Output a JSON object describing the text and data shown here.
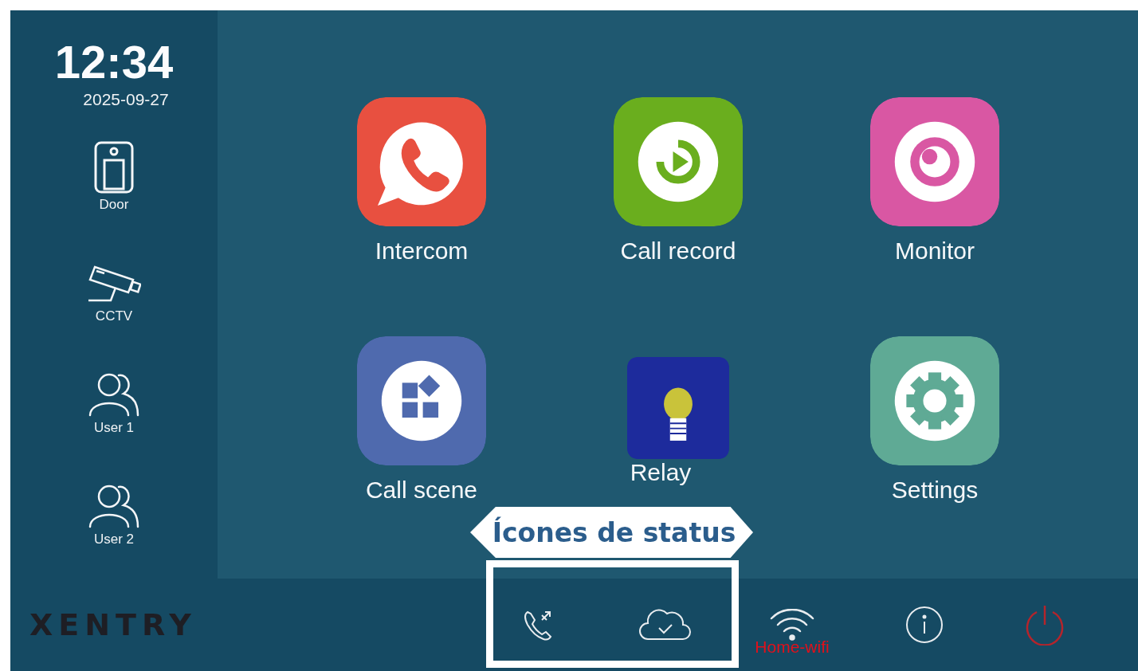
{
  "clock": {
    "time": "12:34",
    "date": "2025-09-27"
  },
  "sidebar": {
    "items": [
      {
        "label": "Door",
        "kind": "door"
      },
      {
        "label": "CCTV",
        "kind": "camera"
      },
      {
        "label": "User 1",
        "kind": "users"
      },
      {
        "label": "User 2",
        "kind": "users"
      }
    ]
  },
  "apps": [
    {
      "label": "Intercom",
      "kind": "phone",
      "color": "#e85040"
    },
    {
      "label": "Call record",
      "kind": "record",
      "color": "#6aae1e"
    },
    {
      "label": "Monitor",
      "kind": "eye",
      "color": "#d957a3"
    },
    {
      "label": "Call scene",
      "kind": "scene",
      "color": "#4f6aae"
    },
    {
      "label": "Relay",
      "kind": "bulb",
      "color": "#1d2b9c"
    },
    {
      "label": "Settings",
      "kind": "gear",
      "color": "#5faa95"
    }
  ],
  "annotation": {
    "label": "Ícones de status"
  },
  "status_bar": {
    "logo": "XENTRY",
    "icons": [
      {
        "kind": "call-forward"
      },
      {
        "kind": "cloud"
      },
      {
        "kind": "wifi",
        "label": "Home-wifi"
      },
      {
        "kind": "info"
      },
      {
        "kind": "power"
      }
    ]
  }
}
